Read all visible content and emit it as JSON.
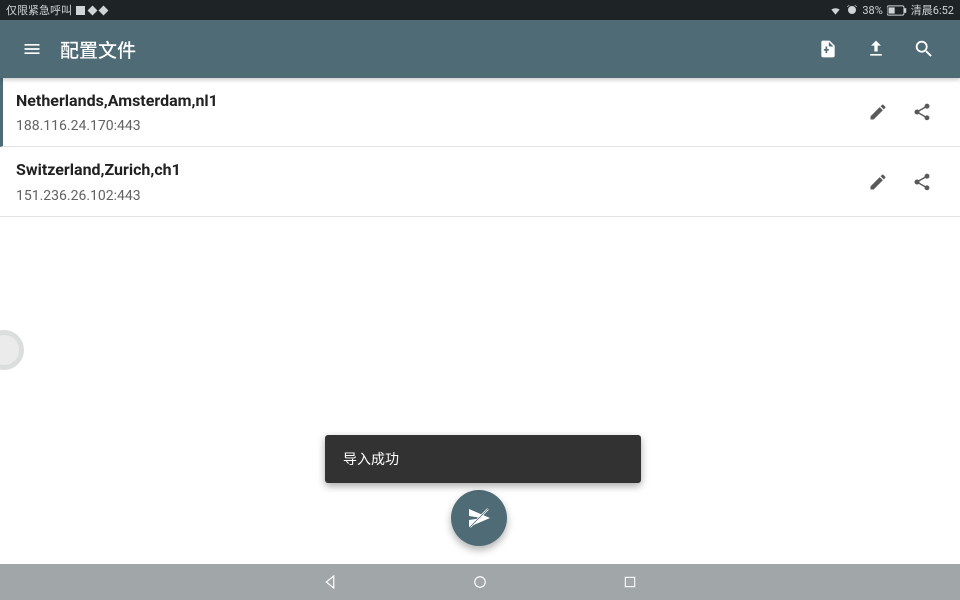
{
  "status": {
    "left_text": "仅限紧急呼叫",
    "battery": "38%",
    "time": "清晨6:52"
  },
  "appbar": {
    "title": "配置文件"
  },
  "profiles": [
    {
      "name": "Netherlands,Amsterdam,nl1",
      "addr": "188.116.24.170:443",
      "selected": true
    },
    {
      "name": "Switzerland,Zurich,ch1",
      "addr": "151.236.26.102:443",
      "selected": false
    }
  ],
  "toast": {
    "text": "导入成功"
  }
}
